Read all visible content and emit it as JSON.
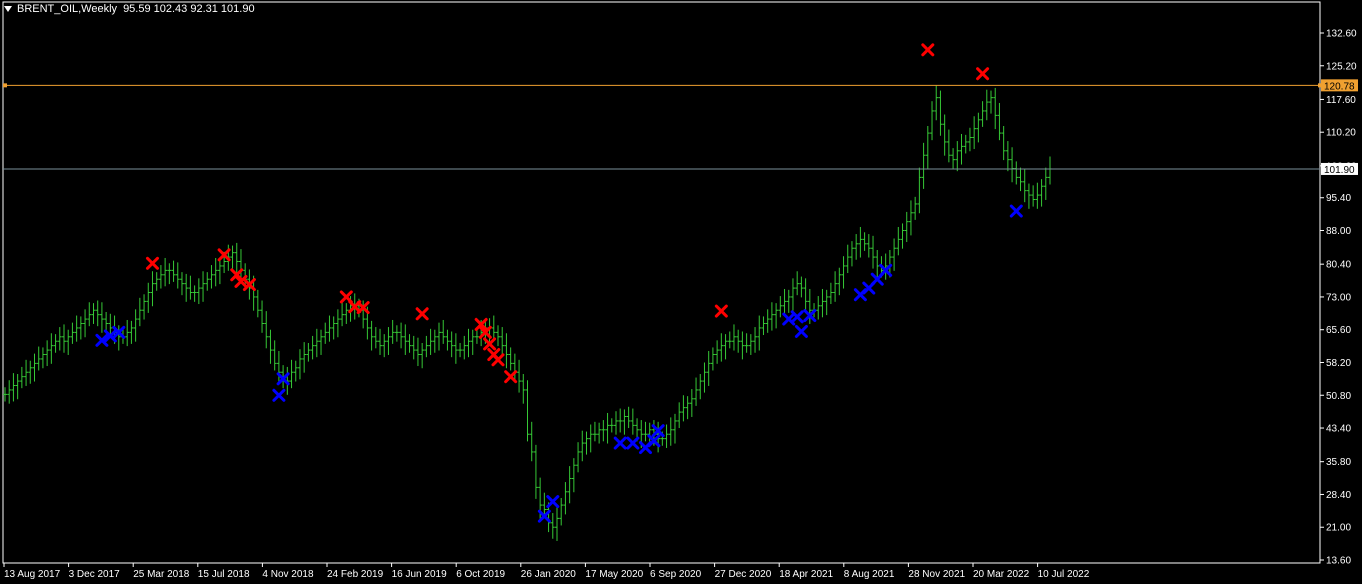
{
  "header": {
    "symbol": "BRENT_OIL,Weekly",
    "ohlc": "95.59 102.43 92.31 101.90"
  },
  "colors": {
    "background": "#000000",
    "bars": "#36c836",
    "axis": "#ffffff",
    "level_line": "#f0a030",
    "price_line": "#7a8f9a",
    "sell_marker": "#ff0000",
    "buy_marker": "#0000ff"
  },
  "chart_data": {
    "type": "ohlc-bar",
    "y_ticks": [
      "132.60",
      "125.20",
      "117.60",
      "110.20",
      "102.60",
      "95.40",
      "88.00",
      "80.40",
      "73.00",
      "65.60",
      "58.20",
      "50.80",
      "43.40",
      "35.80",
      "28.40",
      "21.00",
      "13.60"
    ],
    "ylim": [
      13.6,
      132.6
    ],
    "x_labels": [
      "13 Aug 2017",
      "3 Dec 2017",
      "25 Mar 2018",
      "15 Jul 2018",
      "4 Nov 2018",
      "24 Feb 2019",
      "16 Jun 2019",
      "6 Oct 2019",
      "26 Jan 2020",
      "17 May 2020",
      "6 Sep 2020",
      "27 Dec 2020",
      "18 Apr 2021",
      "8 Aug 2021",
      "28 Nov 2021",
      "20 Mar 2022",
      "10 Jul 2022"
    ],
    "horizontal_level": {
      "value": 120.78,
      "label": "120.78"
    },
    "current_price": {
      "value": 101.9,
      "label": "101.90"
    },
    "series": [
      {
        "values": [
          51,
          52,
          53,
          54,
          55,
          56,
          57,
          58,
          59,
          60,
          61,
          62,
          63,
          64,
          63,
          64,
          65,
          66,
          67,
          68,
          69,
          70,
          69,
          68,
          67,
          66,
          65,
          64,
          64,
          65,
          66,
          68,
          70,
          72,
          74,
          76,
          77,
          78,
          79,
          79,
          78,
          77,
          76,
          75,
          74,
          74,
          75,
          76,
          77,
          78,
          79,
          80,
          81,
          82,
          83,
          81,
          79,
          77,
          75,
          73,
          70,
          67,
          64,
          61,
          58,
          56,
          55,
          54,
          56,
          57,
          59,
          60,
          61,
          62,
          63,
          64,
          65,
          66,
          67,
          68,
          69,
          70,
          71,
          71,
          70,
          68,
          66,
          64,
          63,
          62,
          63,
          64,
          65,
          65,
          64,
          63,
          62,
          61,
          60,
          61,
          62,
          63,
          64,
          65,
          64,
          63,
          62,
          61,
          61,
          62,
          63,
          64,
          64,
          65,
          66,
          66,
          65,
          64,
          62,
          60,
          58,
          56,
          54,
          52,
          42,
          38,
          30,
          26,
          25,
          22,
          21,
          23,
          26,
          29,
          32,
          35,
          38,
          40,
          41,
          42,
          42,
          43,
          43,
          44,
          44,
          45,
          45,
          46,
          45,
          44,
          43,
          42,
          42,
          43,
          42,
          41,
          41,
          42,
          43,
          45,
          47,
          48,
          49,
          50,
          52,
          54,
          56,
          58,
          60,
          61,
          62,
          63,
          63,
          64,
          63,
          62,
          62,
          63,
          64,
          66,
          67,
          68,
          69,
          70,
          71,
          72,
          73,
          75,
          76,
          75,
          72,
          70,
          70,
          71,
          72,
          73,
          74,
          76,
          78,
          80,
          82,
          84,
          85,
          86,
          85,
          84,
          82,
          80,
          79,
          80,
          82,
          84,
          86,
          88,
          90,
          92,
          94,
          100,
          105,
          110,
          115,
          118,
          112,
          108,
          105,
          104,
          106,
          107,
          108,
          109,
          111,
          113,
          115,
          117,
          118,
          114,
          110,
          106,
          104,
          102,
          100,
          99,
          97,
          96,
          95,
          96,
          98,
          100,
          101.9
        ]
      }
    ],
    "sell_markers": [
      {
        "x_index": 35,
        "value": 80.6
      },
      {
        "x_index": 52,
        "value": 82.5
      },
      {
        "x_index": 55,
        "value": 78.0
      },
      {
        "x_index": 56,
        "value": 76.5
      },
      {
        "x_index": 58,
        "value": 75.8
      },
      {
        "x_index": 81,
        "value": 73.0
      },
      {
        "x_index": 83,
        "value": 70.8
      },
      {
        "x_index": 85,
        "value": 70.6
      },
      {
        "x_index": 99,
        "value": 69.2
      },
      {
        "x_index": 113,
        "value": 66.8
      },
      {
        "x_index": 114,
        "value": 65.0
      },
      {
        "x_index": 115,
        "value": 62.4
      },
      {
        "x_index": 116,
        "value": 60.0
      },
      {
        "x_index": 117,
        "value": 58.8
      },
      {
        "x_index": 120,
        "value": 55.0
      },
      {
        "x_index": 170,
        "value": 69.8
      },
      {
        "x_index": 219,
        "value": 128.8
      },
      {
        "x_index": 232,
        "value": 123.4
      }
    ],
    "buy_markers": [
      {
        "x_index": 23,
        "value": 63.2
      },
      {
        "x_index": 25,
        "value": 64.2
      },
      {
        "x_index": 27,
        "value": 65.0
      },
      {
        "x_index": 66,
        "value": 54.5
      },
      {
        "x_index": 65,
        "value": 50.8
      },
      {
        "x_index": 128,
        "value": 23.5
      },
      {
        "x_index": 130,
        "value": 26.8
      },
      {
        "x_index": 146,
        "value": 40.0
      },
      {
        "x_index": 149,
        "value": 40.0
      },
      {
        "x_index": 152,
        "value": 39.0
      },
      {
        "x_index": 154,
        "value": 40.5
      },
      {
        "x_index": 155,
        "value": 42.8
      },
      {
        "x_index": 186,
        "value": 68.0
      },
      {
        "x_index": 188,
        "value": 68.5
      },
      {
        "x_index": 189,
        "value": 65.2
      },
      {
        "x_index": 191,
        "value": 68.8
      },
      {
        "x_index": 203,
        "value": 73.5
      },
      {
        "x_index": 205,
        "value": 75.0
      },
      {
        "x_index": 207,
        "value": 77.0
      },
      {
        "x_index": 209,
        "value": 79.0
      },
      {
        "x_index": 240,
        "value": 92.4
      }
    ]
  }
}
